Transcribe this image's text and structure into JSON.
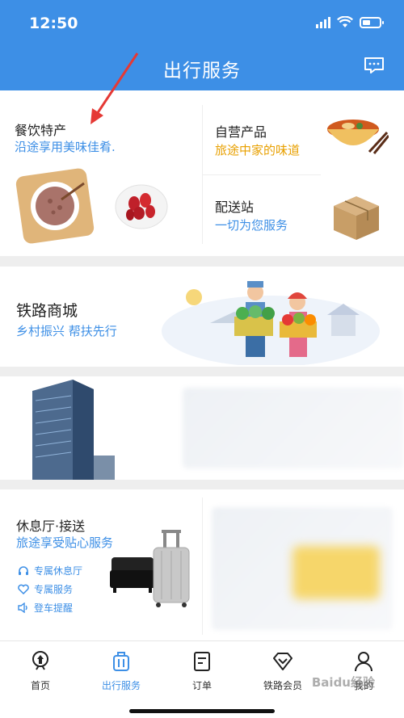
{
  "status": {
    "time": "12:50"
  },
  "header": {
    "title": "出行服务",
    "message_icon": "message-icon"
  },
  "catering": {
    "title": "餐饮特产",
    "subtitle": "沿途享用美味佳肴."
  },
  "self_products": {
    "title": "自营产品",
    "subtitle": "旅途中家的味道"
  },
  "delivery": {
    "title": "配送站",
    "subtitle": "一切为您服务"
  },
  "mall": {
    "title": "铁路商城",
    "subtitle": "乡村振兴 帮扶先行"
  },
  "lounge": {
    "title": "休息厅·接送",
    "subtitle": "旅途享受贴心服务",
    "items": [
      {
        "icon": "headset-icon",
        "label": "专属休息厅"
      },
      {
        "icon": "heart-icon",
        "label": "专属服务"
      },
      {
        "icon": "speaker-icon",
        "label": "登车提醒"
      }
    ]
  },
  "nav": [
    {
      "label": "首页",
      "icon": "home-icon",
      "active": false
    },
    {
      "label": "出行服务",
      "icon": "suitcase-icon",
      "active": true
    },
    {
      "label": "订单",
      "icon": "order-icon",
      "active": false
    },
    {
      "label": "铁路会员",
      "icon": "diamond-icon",
      "active": false
    },
    {
      "label": "我的",
      "icon": "profile-icon",
      "active": false
    }
  ],
  "watermark": "Baidu经验",
  "colors": {
    "accent": "#3d8fe6",
    "orange": "#e8a000",
    "arrow": "#e53935"
  }
}
